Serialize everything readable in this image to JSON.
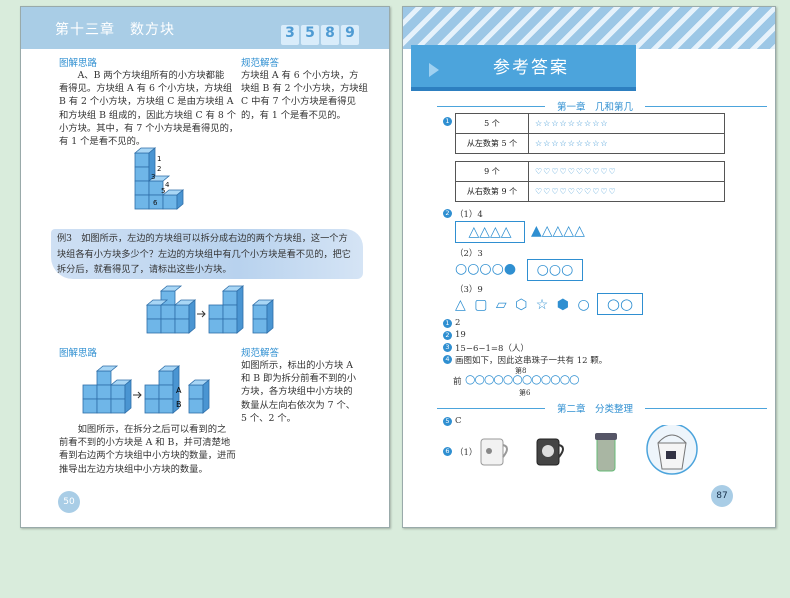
{
  "left_page": {
    "chapter": "第十三章　数方块",
    "chapter_nums": [
      "3",
      "5",
      "8",
      "9"
    ],
    "top": {
      "analysis_label": "图解思路",
      "analysis_text": [
        "　　A、B 两个方块组所有的小方块都能",
        "看得见。方块组 A 有 6 个小方块，方块组",
        "B 有 2 个小方块，方块组 C 是由方块组 A",
        "和方块组 B 组成的，因此方块组 C 有 8 个",
        "小方块。其中，有 7 个小方块是看得见的，",
        "有 1 个是看不见的。"
      ],
      "answer_label": "规范解答",
      "answer_text": [
        "方块组 A 有 6 个小方块，方",
        "块组 B 有 2 个小方块，方块组",
        "C 中有 7 个小方块是看得见",
        "的，有 1 个是看不见的。"
      ]
    },
    "cube_labels": [
      "1",
      "2",
      "3",
      "4",
      "5",
      "6"
    ],
    "example": {
      "text": [
        "例3　如图所示，左边的方块组可以拆分成右边的两个方块组，这一个方",
        "块组各有小方块多少个？左边的方块组中有几个小方块是看不见的，把它",
        "拆分后，就看得见了，请标出这些小方块。"
      ]
    },
    "bottom": {
      "analysis_label": "图解思路",
      "analysis_text": [
        "　　如图所示，在拆分之后可以看到的之",
        "前看不到的小方块是 A 和 B，并可清楚地",
        "看到右边两个方块组中小方块的数量，进而",
        "推导出左边方块组中小方块的数量。"
      ],
      "answer_label": "规范解答",
      "answer_text": [
        "如图所示，标出的小方块 A",
        "和 B 即为拆分前看不到的小",
        "方块，各方块组中小方块的",
        "数量从左向右依次为 7 个、",
        "5 个、2 个。"
      ],
      "cube_marks": [
        "A",
        "B"
      ]
    },
    "page_number": "50"
  },
  "right_page": {
    "banner": "参考答案",
    "chapter1": "第一章　几和第几",
    "q1": {
      "table": [
        {
          "label": "5 个",
          "shapes": "☆☆☆☆☆☆☆☆☆"
        },
        {
          "label": "从左数第 5 个",
          "shapes": "☆☆☆☆☆☆☆☆☆"
        },
        {
          "label": "9 个",
          "shapes": "♡♡♡♡♡♡♡♡♡♡"
        },
        {
          "label": "从右数第 9 个",
          "shapes": "♡♡♡♡♡♡♡♡♡♡"
        }
      ]
    },
    "q2": {
      "p1": "（1）4",
      "p2": "（2）3",
      "p3": "（3）9",
      "tri": "△△△△",
      "tri2": "▲△△△△",
      "circ": "○○○○●",
      "circ2": "○○○",
      "mix": "△ ▢ ▱ ⬡ ☆ ⬢ ○",
      "circ3": "○○"
    },
    "q3": "2",
    "q4": "19",
    "q5": "15−6−1=8（人）",
    "q6": "画图如下，因此这串珠子一共有 12 颗。",
    "bead_front": "前",
    "bead_row": "○○○○○○○○○○○○",
    "bead_label_top": "第8",
    "bead_label_bottom": "第6",
    "chapter2": "第二章　分类整理",
    "q7": "C",
    "q8": "（1）",
    "bullets": [
      "1",
      "2",
      "1",
      "2",
      "3",
      "4",
      "5",
      "6",
      "1",
      "2"
    ],
    "page_number": "87"
  }
}
